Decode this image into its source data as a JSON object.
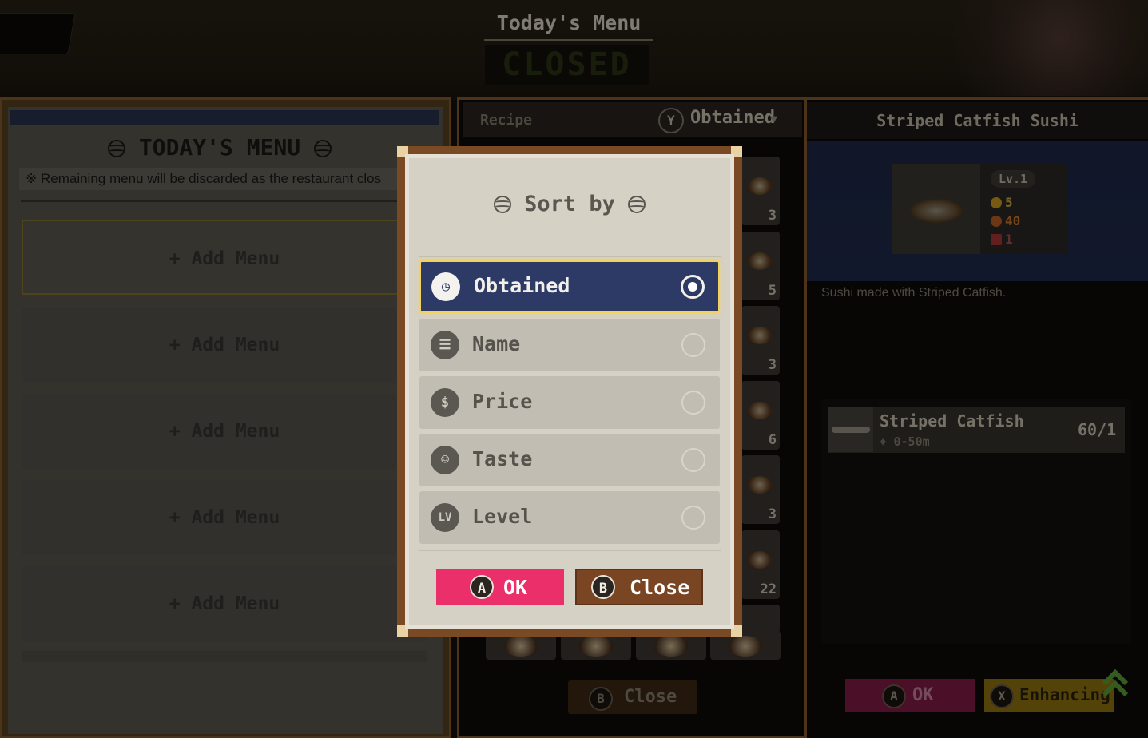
{
  "header": {
    "title": "Today's Menu",
    "status_sign": "CLOSED"
  },
  "left_panel": {
    "heading": "TODAY'S MENU",
    "notice": "※ Remaining menu will be discarded as the restaurant clos",
    "slots": [
      "+ Add Menu",
      "+ Add Menu",
      "+ Add Menu",
      "+ Add Menu",
      "+ Add Menu"
    ]
  },
  "recipe_panel": {
    "label": "Recipe",
    "sort_button_key": "Y",
    "sort_current": "Obtained",
    "cards": [
      "3",
      "5",
      "3",
      "6",
      "3",
      "22"
    ],
    "close_button": {
      "key": "B",
      "label": "Close"
    }
  },
  "detail_panel": {
    "title": "Striped Catfish Sushi",
    "level": "Lv.1",
    "stats": {
      "coins": "5",
      "taste": "40",
      "quantity": "1"
    },
    "description": "Sushi made with Striped Catfish.",
    "ingredient": {
      "name": "Striped Catfish",
      "location": "0-50m",
      "count": "60/1"
    },
    "ok_button": {
      "key": "A",
      "label": "OK"
    },
    "enhance_button": {
      "key": "X",
      "label": "Enhancing"
    }
  },
  "sort_modal": {
    "title": "Sort by",
    "options": [
      {
        "label": "Obtained",
        "icon": "clock-icon",
        "glyph": "◷",
        "selected": true
      },
      {
        "label": "Name",
        "icon": "list-icon",
        "glyph": "☰",
        "selected": false
      },
      {
        "label": "Price",
        "icon": "dollar-icon",
        "glyph": "$",
        "selected": false
      },
      {
        "label": "Taste",
        "icon": "smile-icon",
        "glyph": "☺",
        "selected": false
      },
      {
        "label": "Level",
        "icon": "level-icon",
        "glyph": "LV",
        "selected": false
      }
    ],
    "ok_button": {
      "key": "A",
      "label": "OK"
    },
    "close_button": {
      "key": "B",
      "label": "Close"
    }
  },
  "colors": {
    "accent_pink": "#ea2f6b",
    "selected_navy": "#2d3a66",
    "selected_border": "#f2d25a",
    "frame_brown": "#7a4a25"
  }
}
